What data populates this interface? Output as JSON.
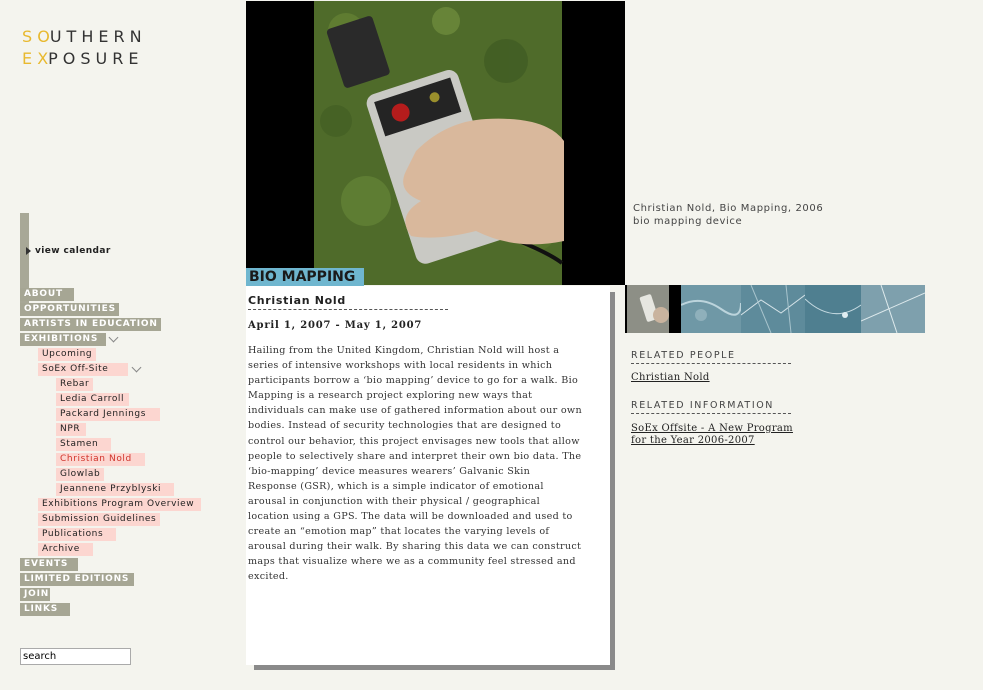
{
  "logo": {
    "line1_mark": "S O",
    "line1_rest": "UTHERN",
    "line2_mark": "E X",
    "line2_rest": "POSURE"
  },
  "nav": {
    "view_calendar": "view calendar",
    "items": [
      {
        "label": "ABOUT"
      },
      {
        "label": "OPPORTUNITIES"
      },
      {
        "label": "ARTISTS IN EDUCATION"
      },
      {
        "label": "EXHIBITIONS"
      },
      {
        "label": "Upcoming"
      },
      {
        "label": "SoEx Off-Site"
      },
      {
        "label": "Rebar"
      },
      {
        "label": "Ledia Carroll"
      },
      {
        "label": "Packard Jennings"
      },
      {
        "label": "NPR"
      },
      {
        "label": "Stamen"
      },
      {
        "label": "Christian Nold"
      },
      {
        "label": "Glowlab"
      },
      {
        "label": "Jeannene Przyblyski"
      },
      {
        "label": "Exhibitions Program Overview"
      },
      {
        "label": "Submission Guidelines"
      },
      {
        "label": "Publications"
      },
      {
        "label": "Archive"
      },
      {
        "label": "EVENTS"
      },
      {
        "label": "LIMITED EDITIONS"
      },
      {
        "label": "JOIN"
      },
      {
        "label": "LINKS"
      }
    ]
  },
  "search": {
    "value": "search"
  },
  "caption": {
    "line1": "Christian Nold, Bio Mapping, 2006",
    "line2": "bio mapping device"
  },
  "exhibition": {
    "title": "BIO MAPPING",
    "artist": "Christian Nold",
    "dates": "April 1, 2007 - May 1, 2007",
    "description": "Hailing from the United Kingdom, Christian Nold will host a series of intensive workshops with local residents in which participants borrow a ‘bio mapping’ device to go for a walk. Bio Mapping is a research project exploring new ways that individuals can make use of gathered information about our own bodies. Instead of security technologies that are designed to control our behavior, this project envisages new tools that allow people to selectively share and interpret their own bio data. The ‘bio-mapping’ device measures wearers’ Galvanic Skin Response (GSR), which is a simple indicator of emotional arousal in conjunction with their physical / geographical location using a GPS. The data will be downloaded and used to create an “emotion map” that locates the varying levels of arousal during their walk. By sharing this data we can construct maps that visualize where we as a community feel stressed and excited."
  },
  "related": {
    "people_heading": "RELATED PEOPLE",
    "people": [
      "Christian Nold"
    ],
    "info_heading": "RELATED INFORMATION",
    "info_line1": "SoEx Offsite - A New Program",
    "info_line2": "for the Year 2006-2007"
  },
  "colors": {
    "nav_main": "#a6a694",
    "nav_sub": "#fcd6d0",
    "active": "#d0352c",
    "title_tab": "#6fb6cf",
    "logo_accent": "#e8b92f"
  }
}
